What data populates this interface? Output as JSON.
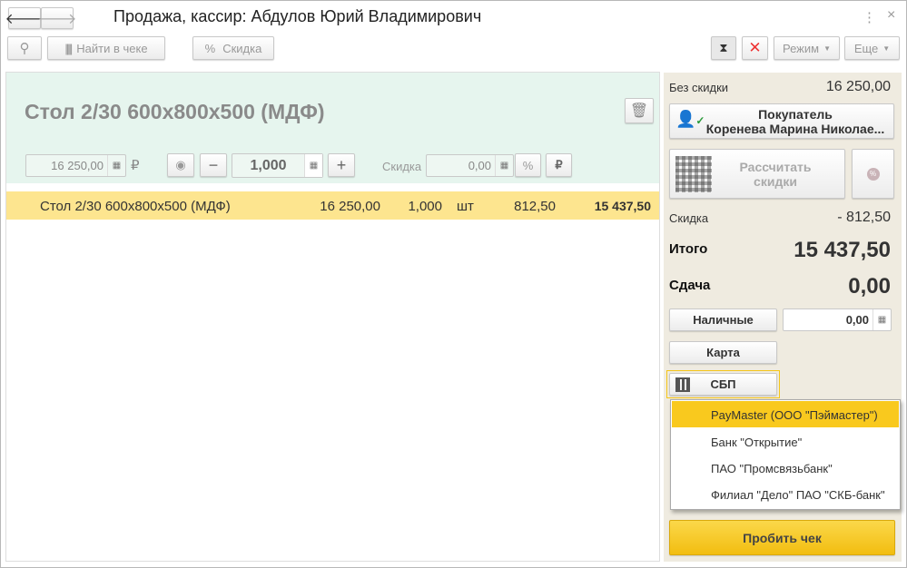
{
  "window": {
    "title": "Продажа, кассир: Абдулов Юрий Владимирович",
    "more": "⋮",
    "close": "×"
  },
  "toolbar": {
    "find_in_receipt": "Найти в чеке",
    "discount": "Скидка",
    "mode": "Режим",
    "more": "Еще"
  },
  "product": {
    "title": "Стол 2/30 600x800x500 (МДФ)",
    "price": "16 250,00",
    "currency": "₽",
    "quantity": "1,000",
    "discount_label": "Скидка",
    "discount": "0,00",
    "percent": "%",
    "ruble": "₽"
  },
  "lines": [
    {
      "name": "Стол 2/30 600x800x500 (МДФ)",
      "price": "16 250,00",
      "qty": "1,000",
      "unit": "шт",
      "discount": "812,50",
      "total": "15 437,50"
    }
  ],
  "summary": {
    "no_discount_label": "Без скидки",
    "no_discount": "16 250,00",
    "buyer_label": "Покупатель",
    "buyer_name": "Коренева Марина Николае...",
    "calc_discounts": "Рассчитать скидки",
    "discount_label": "Скидка",
    "discount": "- 812,50",
    "total_label": "Итого",
    "total": "15 437,50",
    "change_label": "Сдача",
    "change": "0,00",
    "cash": "Наличные",
    "cash_amount": "0,00",
    "card": "Карта",
    "sbp": "СБП",
    "print_receipt": "Пробить чек"
  },
  "sbp_menu": [
    "PayMaster (ООО \"Пэймастер\")",
    "Банк \"Открытие\"",
    "ПАО \"Промсвязьбанк\"",
    "Филиал \"Дело\" ПАО \"СКБ-банк\""
  ],
  "colors": {
    "accent": "#f9c91e",
    "row_selected": "#fde58f",
    "product_bg": "#e6f5ee",
    "side_bg": "#efebe0"
  }
}
